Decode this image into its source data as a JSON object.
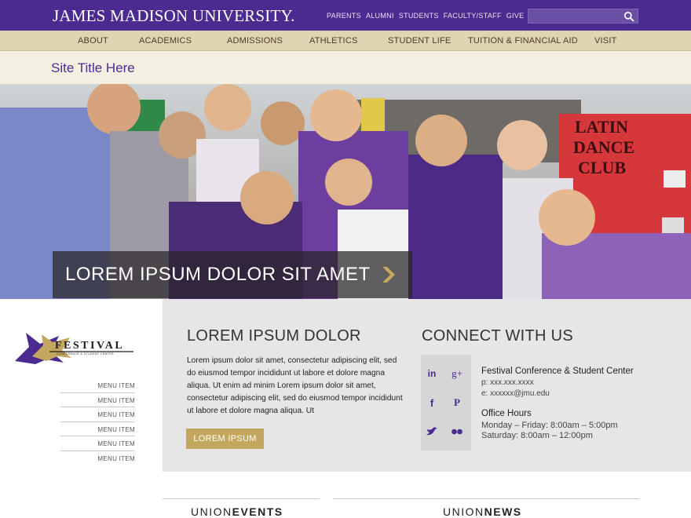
{
  "header": {
    "university_name": "JAMES MADISON UNIVERSITY.",
    "utility_links": [
      "PARENTS",
      "ALUMNI",
      "STUDENTS",
      "FACULTY/STAFF",
      "GIVE"
    ],
    "search": {
      "placeholder": "",
      "icon": "search-icon"
    }
  },
  "main_nav": [
    "ABOUT",
    "ACADEMICS",
    "ADMISSIONS",
    "ATHLETICS",
    "STUDENT LIFE",
    "TUITION & FINANCIAL AID",
    "VISIT"
  ],
  "site_title": "Site Title Here",
  "hero": {
    "caption": "LOREM IPSUM DOLOR SIT AMET",
    "arrow_icon": "chevron-right-icon",
    "sign_text": [
      "LATIN",
      "DANCE",
      "CLUB"
    ]
  },
  "sidebar": {
    "logo_text": "FESTIVAL",
    "logo_subtext": "CONFERENCE & STUDENT CENTER",
    "menu_items": [
      "MENU ITEM",
      "MENU ITEM",
      "MENU ITEM",
      "MENU ITEM",
      "MENU ITEM",
      "MENU ITEM"
    ]
  },
  "content": {
    "heading": "LOREM IPSUM DOLOR",
    "body": "Lorem ipsum dolor sit amet, consectetur adipiscing elit, sed do eiusmod tempor incididunt ut labore et dolore magna aliqua. Ut enim ad minim Lorem ipsum dolor sit amet, consectetur adipiscing elit, sed do eiusmod tempor incididunt ut labore et dolore magna aliqua. Ut",
    "button_label": "LOREM IPSUM"
  },
  "connect": {
    "heading": "CONNECT WITH US",
    "social_icons": [
      "linkedin-icon",
      "google-plus-icon",
      "facebook-icon",
      "pinterest-icon",
      "twitter-icon",
      "flickr-icon"
    ],
    "social_glyphs": {
      "linkedin": "in",
      "google_plus": "g+",
      "facebook": "f",
      "pinterest": "P"
    },
    "center_name": "Festival Conference & Student Center",
    "phone": "p:  xxx.xxx.xxxx",
    "email": "e: xxxxxx@jmu.edu",
    "hours_title": "Office Hours",
    "hours_weekday": "Monday – Friday: 8:00am – 5:00pm",
    "hours_saturday": "Saturday: 8:00am – 12:00pm"
  },
  "bottom": {
    "events_prefix": "UNION",
    "events_bold": "EVENTS",
    "news_prefix": "UNION",
    "news_bold": "NEWS"
  },
  "colors": {
    "jmu_purple": "#4b2b8f",
    "gold": "#c4a75e",
    "nav_tan": "#dfd5b3",
    "title_cream": "#f4f0e1",
    "panel_gray": "#e6e6e6"
  }
}
